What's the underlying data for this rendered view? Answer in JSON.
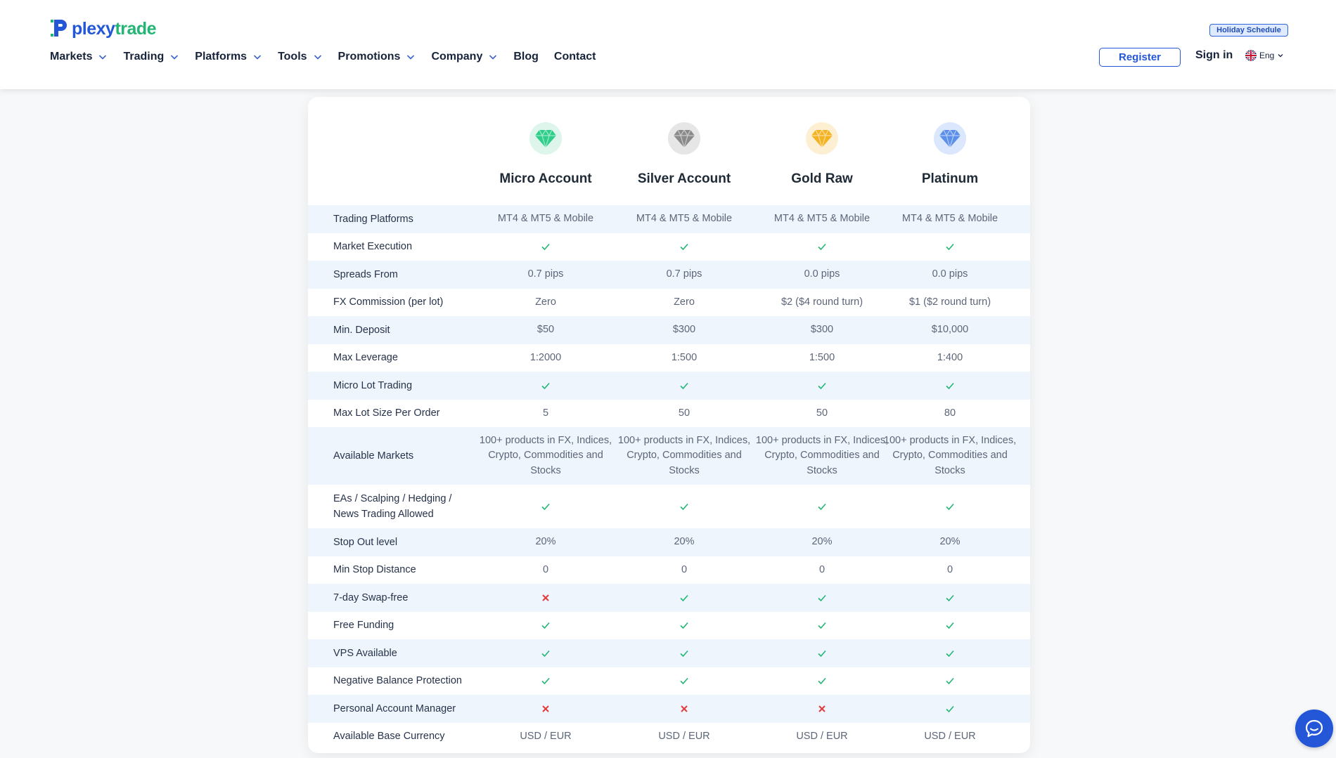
{
  "brand": {
    "part1": "plexy",
    "part2": "trade",
    "colors": {
      "primary": "#2357d8",
      "accent": "#22b573"
    }
  },
  "nav": {
    "items": [
      {
        "label": "Markets",
        "dropdown": true
      },
      {
        "label": "Trading",
        "dropdown": true
      },
      {
        "label": "Platforms",
        "dropdown": true
      },
      {
        "label": "Tools",
        "dropdown": true
      },
      {
        "label": "Promotions",
        "dropdown": true
      },
      {
        "label": "Company",
        "dropdown": true
      },
      {
        "label": "Blog",
        "dropdown": false
      },
      {
        "label": "Contact",
        "dropdown": false
      }
    ]
  },
  "header_right": {
    "holiday": "Holiday Schedule",
    "register": "Register",
    "signin": "Sign in",
    "language": "Eng"
  },
  "accounts": [
    {
      "name": "Micro Account",
      "icon": "green-diamond-icon",
      "color": "#2fcf8b",
      "bg": "#ddf5ea"
    },
    {
      "name": "Silver Account",
      "icon": "silver-diamond-icon",
      "color": "#8a8a8a",
      "bg": "#e6e6e6"
    },
    {
      "name": "Gold Raw",
      "icon": "gold-diamond-icon",
      "color": "#f4b323",
      "bg": "#fdf0d2"
    },
    {
      "name": "Platinum",
      "icon": "platinum-diamond-icon",
      "color": "#5b8fe8",
      "bg": "#dbe7fc"
    }
  ],
  "rows": [
    {
      "label": "Trading Platforms",
      "values": [
        "MT4 & MT5 & Mobile",
        "MT4 & MT5 & Mobile",
        "MT4 & MT5 & Mobile",
        "MT4 & MT5 & Mobile"
      ]
    },
    {
      "label": "Market Execution",
      "values": [
        "check",
        "check",
        "check",
        "check"
      ]
    },
    {
      "label": "Spreads From",
      "values": [
        "0.7 pips",
        "0.7 pips",
        "0.0 pips",
        "0.0 pips"
      ]
    },
    {
      "label": "FX Commission (per lot)",
      "values": [
        "Zero",
        "Zero",
        "$2 ($4 round turn)",
        "$1 ($2 round turn)"
      ]
    },
    {
      "label": "Min. Deposit",
      "values": [
        "$50",
        "$300",
        "$300",
        "$10,000"
      ]
    },
    {
      "label": "Max Leverage",
      "values": [
        "1:2000",
        "1:500",
        "1:500",
        "1:400"
      ]
    },
    {
      "label": "Micro Lot Trading",
      "values": [
        "check",
        "check",
        "check",
        "check"
      ]
    },
    {
      "label": "Max Lot Size Per Order",
      "values": [
        "5",
        "50",
        "50",
        "80"
      ]
    },
    {
      "label": "Available Markets",
      "values": [
        "100+ products in FX, Indices, Crypto, Commodities and Stocks",
        "100+ products in FX, Indices, Crypto, Commodities and Stocks",
        "100+ products in FX, Indices, Crypto, Commodities and Stocks",
        "100+ products in FX, Indices, Crypto, Commodities and Stocks"
      ]
    },
    {
      "label": "EAs / Scalping / Hedging / News Trading Allowed",
      "values": [
        "check",
        "check",
        "check",
        "check"
      ]
    },
    {
      "label": "Stop Out level",
      "values": [
        "20%",
        "20%",
        "20%",
        "20%"
      ]
    },
    {
      "label": "Min Stop Distance",
      "values": [
        "0",
        "0",
        "0",
        "0"
      ]
    },
    {
      "label": "7-day Swap-free",
      "values": [
        "cross",
        "check",
        "check",
        "check"
      ]
    },
    {
      "label": "Free Funding",
      "values": [
        "check",
        "check",
        "check",
        "check"
      ]
    },
    {
      "label": "VPS Available",
      "values": [
        "check",
        "check",
        "check",
        "check"
      ]
    },
    {
      "label": "Negative Balance Protection",
      "values": [
        "check",
        "check",
        "check",
        "check"
      ]
    },
    {
      "label": "Personal Account Manager",
      "values": [
        "cross",
        "cross",
        "cross",
        "check"
      ]
    },
    {
      "label": "Available Base Currency",
      "values": [
        "USD / EUR",
        "USD / EUR",
        "USD / EUR",
        "USD / EUR"
      ]
    }
  ],
  "status_colors": {
    "check": "#22b573",
    "cross": "#e23b3b"
  }
}
